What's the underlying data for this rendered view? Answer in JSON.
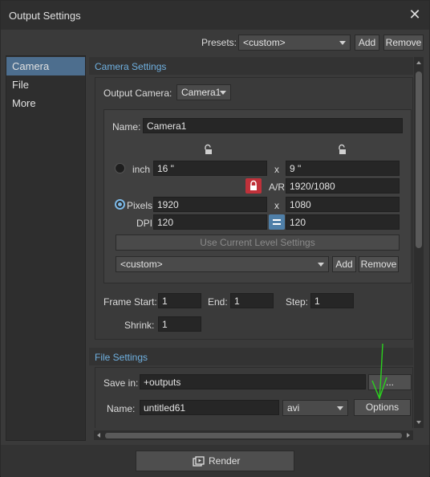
{
  "window": {
    "title": "Output Settings",
    "close_glyph": "✕"
  },
  "presets": {
    "label": "Presets:",
    "value": "<custom>",
    "add": "Add",
    "remove": "Remove"
  },
  "sidebar": {
    "items": [
      {
        "label": "Camera"
      },
      {
        "label": "File"
      },
      {
        "label": "More"
      }
    ]
  },
  "camera_settings": {
    "header": "Camera Settings",
    "output_camera_label": "Output Camera:",
    "output_camera_value": "Camera1",
    "name_label": "Name:",
    "name_value": "Camera1",
    "inch_label": "inch",
    "width_inch": "16 \"",
    "x1": "x",
    "height_inch": "9 \"",
    "ar_label": "A/R",
    "ar_value": "1920/1080",
    "pixels_label": "Pixels",
    "width_px": "1920",
    "x2": "x",
    "height_px": "1080",
    "dpi_label": "DPI",
    "dpi_x": "120",
    "dpi_y": "120",
    "use_current_level": "Use Current Level Settings",
    "preset_value": "<custom>",
    "preset_add": "Add",
    "preset_remove": "Remove",
    "frame_start_label": "Frame Start:",
    "frame_start": "1",
    "end_label": "End:",
    "end": "1",
    "step_label": "Step:",
    "step": "1",
    "shrink_label": "Shrink:",
    "shrink": "1"
  },
  "file_settings": {
    "header": "File Settings",
    "save_in_label": "Save in:",
    "save_in_value": "+outputs",
    "browse": "...",
    "name_label": "Name:",
    "name_value": "untitled61",
    "format": "avi",
    "options": "Options"
  },
  "render": {
    "label": "Render"
  },
  "colors": {
    "accent": "#6fb0e0",
    "selected": "#4d6e8e",
    "lock_red": "#c0313a",
    "link_blue": "#4f7fa8",
    "annotation": "#2bd21e"
  }
}
